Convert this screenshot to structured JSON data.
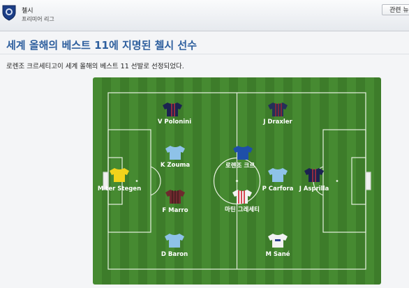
{
  "header": {
    "club_name": "첼시",
    "league_name": "프리미어 리그",
    "news_button_label": "관련 뉴"
  },
  "article": {
    "headline": "세계 올해의 베스트 11에 지명된 첼시 선수",
    "body": "로렌조 크르세티고이 세계 올해의 베스트 11 선발로 선정되었다."
  },
  "colors": {
    "headline": "#2e5f9e",
    "pitch_dark": "#3f7f2c",
    "pitch_light": "#4a8c34",
    "lines": "#e9f3e3"
  },
  "formation": {
    "players": [
      {
        "name": "V Polonini",
        "kit": "navy-stripe"
      },
      {
        "name": "J Draxler",
        "kit": "navy-red"
      },
      {
        "name": "K Zouma",
        "kit": "sky"
      },
      {
        "name": "로렌조 크르",
        "kit": "chelsea-blue"
      },
      {
        "name": "M ter Stegen",
        "kit": "gk-yellow"
      },
      {
        "name": "P Carfora",
        "kit": "sky"
      },
      {
        "name": "J Asprilla",
        "kit": "navy-stripe"
      },
      {
        "name": "F Marro",
        "kit": "maroon"
      },
      {
        "name": "마틴 그레세티",
        "kit": "red-white"
      },
      {
        "name": "D Baron",
        "kit": "sky"
      },
      {
        "name": "M Sané",
        "kit": "white"
      }
    ]
  }
}
